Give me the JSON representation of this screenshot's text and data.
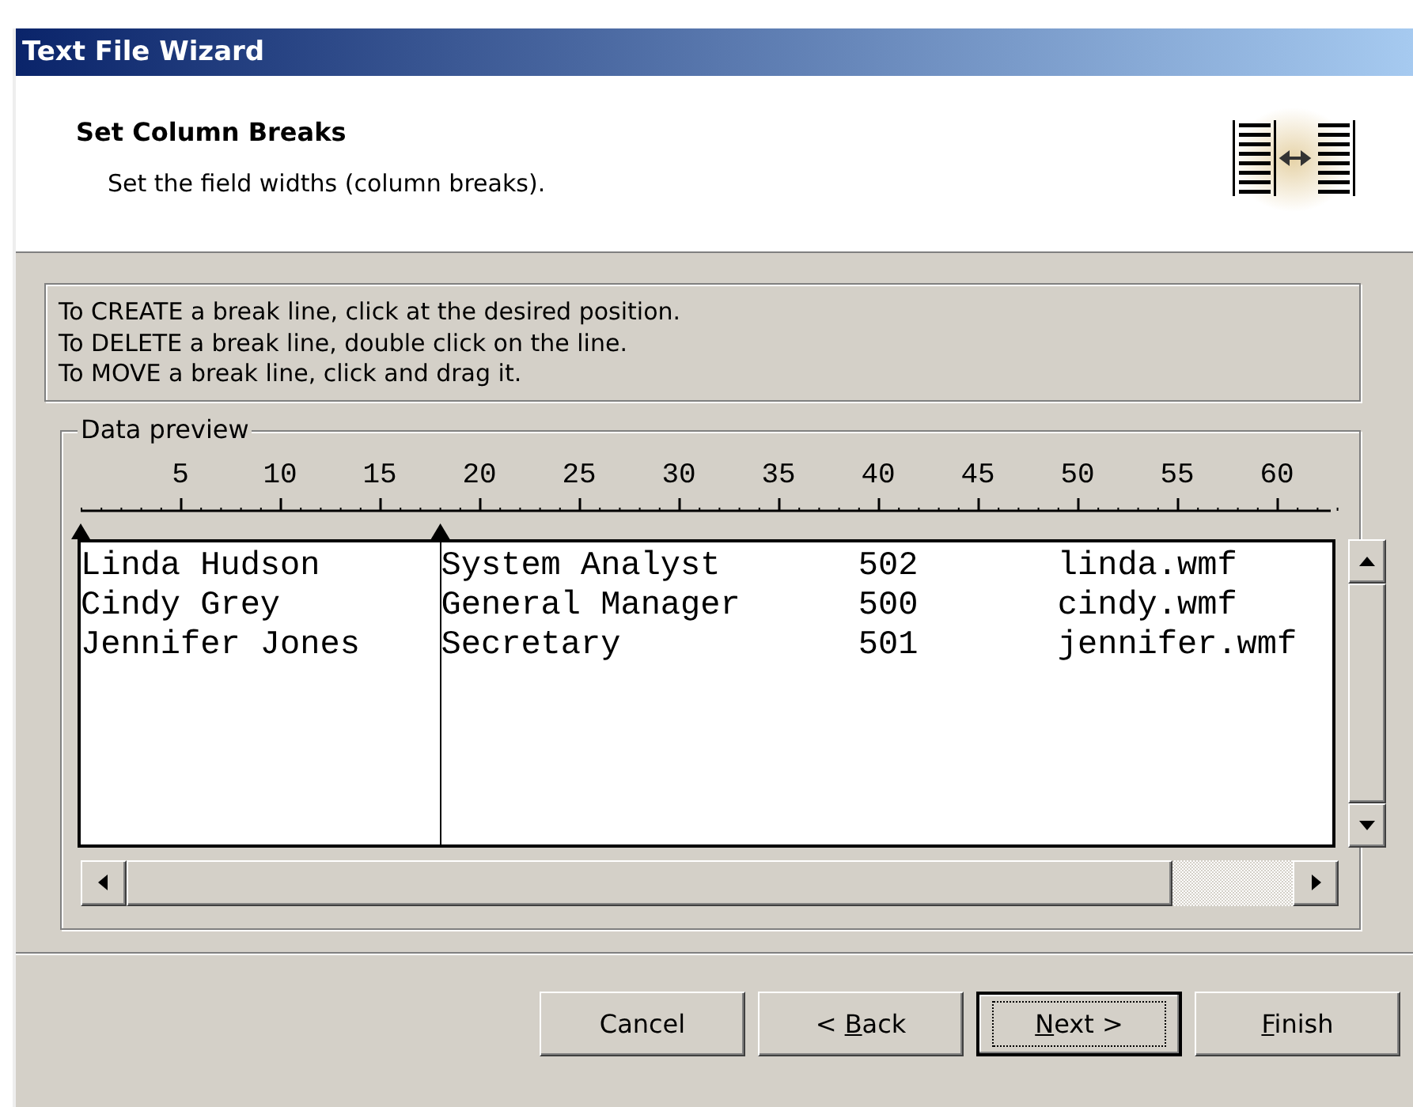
{
  "window": {
    "title": "Text File Wizard"
  },
  "header": {
    "title": "Set Column Breaks",
    "subtitle": "Set the field widths (column breaks)."
  },
  "instructions": [
    "To CREATE a break line, click at the desired position.",
    "To DELETE a break line, double click on the line.",
    "To MOVE a break line, click and drag it."
  ],
  "data_preview": {
    "label": "Data preview",
    "ruler_labels": [
      "5",
      "10",
      "15",
      "20",
      "25",
      "30",
      "35",
      "40",
      "45",
      "50",
      "55",
      "60"
    ],
    "columns": [
      {
        "break": true
      },
      {
        "break": true
      },
      {
        "break": false
      },
      {
        "break": false
      }
    ],
    "rows": [
      [
        "Linda Hudson",
        "System Analyst",
        "502",
        "linda.wmf"
      ],
      [
        "Cindy Grey",
        "General Manager",
        "500",
        "cindy.wmf"
      ],
      [
        "Jennifer Jones",
        "Secretary",
        "501",
        "jennifer.wmf"
      ]
    ]
  },
  "buttons": [
    {
      "before": "Cancel",
      "default": false
    },
    {
      "before": "< ",
      "key": "B",
      "after": "ack",
      "default": false
    },
    {
      "key": "N",
      "after": "ext >",
      "default": true
    },
    {
      "key": "F",
      "after": "inish",
      "default": false
    }
  ]
}
